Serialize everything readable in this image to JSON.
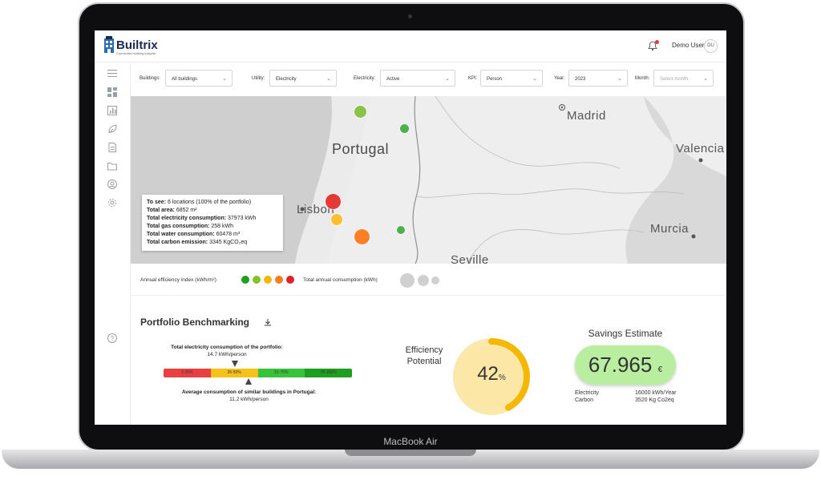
{
  "device": {
    "label": "MacBook Air"
  },
  "header": {
    "brand": "Builtrix",
    "tagline": "Connected building insights",
    "user_name": "Demo User",
    "user_initials": "DU"
  },
  "filters": [
    {
      "label": "Buildings:",
      "value": "All buildings"
    },
    {
      "label": "Utility:",
      "value": "Electricity"
    },
    {
      "label": "Electricity:",
      "value": "Active"
    },
    {
      "label": "KPI:",
      "value": "Person"
    },
    {
      "label": "Year:",
      "value": "2023"
    },
    {
      "label": "Month:",
      "placeholder": "Select month"
    }
  ],
  "map": {
    "labels": {
      "portugal": "Portugal",
      "madrid": "Madrid",
      "valencia": "Valencia",
      "lisbon": "Lisbon",
      "murcia": "Murcia",
      "seville": "Seville"
    },
    "info": {
      "see_label": "To see:",
      "see_value": "6 locations (100% of the portfolio)",
      "area_label": "Total area:",
      "area_value": "6852 m²",
      "elec_label": "Total electricity consumption:",
      "elec_value": "37973 kWh",
      "gas_label": "Total gas consumption:",
      "gas_value": "258 kWh",
      "water_label": "Total water consumption:",
      "water_value": "60478 m³",
      "carbon_label": "Total carbon emission:",
      "carbon_value": "3345 KgCO₂eq"
    },
    "markers": [
      {
        "color": "#8bc34a"
      },
      {
        "color": "#4caf50"
      },
      {
        "color": "#e53935"
      },
      {
        "color": "#fbc02d"
      },
      {
        "color": "#ff7f27"
      },
      {
        "color": "#4caf50"
      }
    ]
  },
  "legend": {
    "efficiency_label": "Annual efficiency index (kWh/m²)",
    "efficiency_colors": [
      "#1aa21a",
      "#86c21e",
      "#f2b705",
      "#f57c1f",
      "#e5202a"
    ],
    "consumption_label": "Total annual consumption (kWh)"
  },
  "benchmark": {
    "title": "Portfolio Benchmarking",
    "top_text": "Total electricity consumption of the portfolio:",
    "top_value": "14.7 kWh/person",
    "bar_segments": [
      {
        "label": "0-25%",
        "color": "#e84040"
      },
      {
        "label": "26-50%",
        "color": "#f5c219"
      },
      {
        "label": "51-75%",
        "color": "#37c23a"
      },
      {
        "label": "76-100%",
        "color": "#1e9e1e"
      }
    ],
    "bottom_text": "Average consumption of similar buildings in Portugal:",
    "bottom_value": "11.2 kWh/person"
  },
  "efficiency": {
    "title": "Efficiency Potential",
    "value": "42",
    "unit": "%",
    "percent": 42
  },
  "savings": {
    "title": "Savings Estimate",
    "value": "67.965",
    "currency": "€",
    "rows": [
      {
        "label": "Electricity",
        "value": "16000 kWh/Year"
      },
      {
        "label": "Carbon",
        "value": "3520 Kg Co2eq"
      }
    ]
  }
}
